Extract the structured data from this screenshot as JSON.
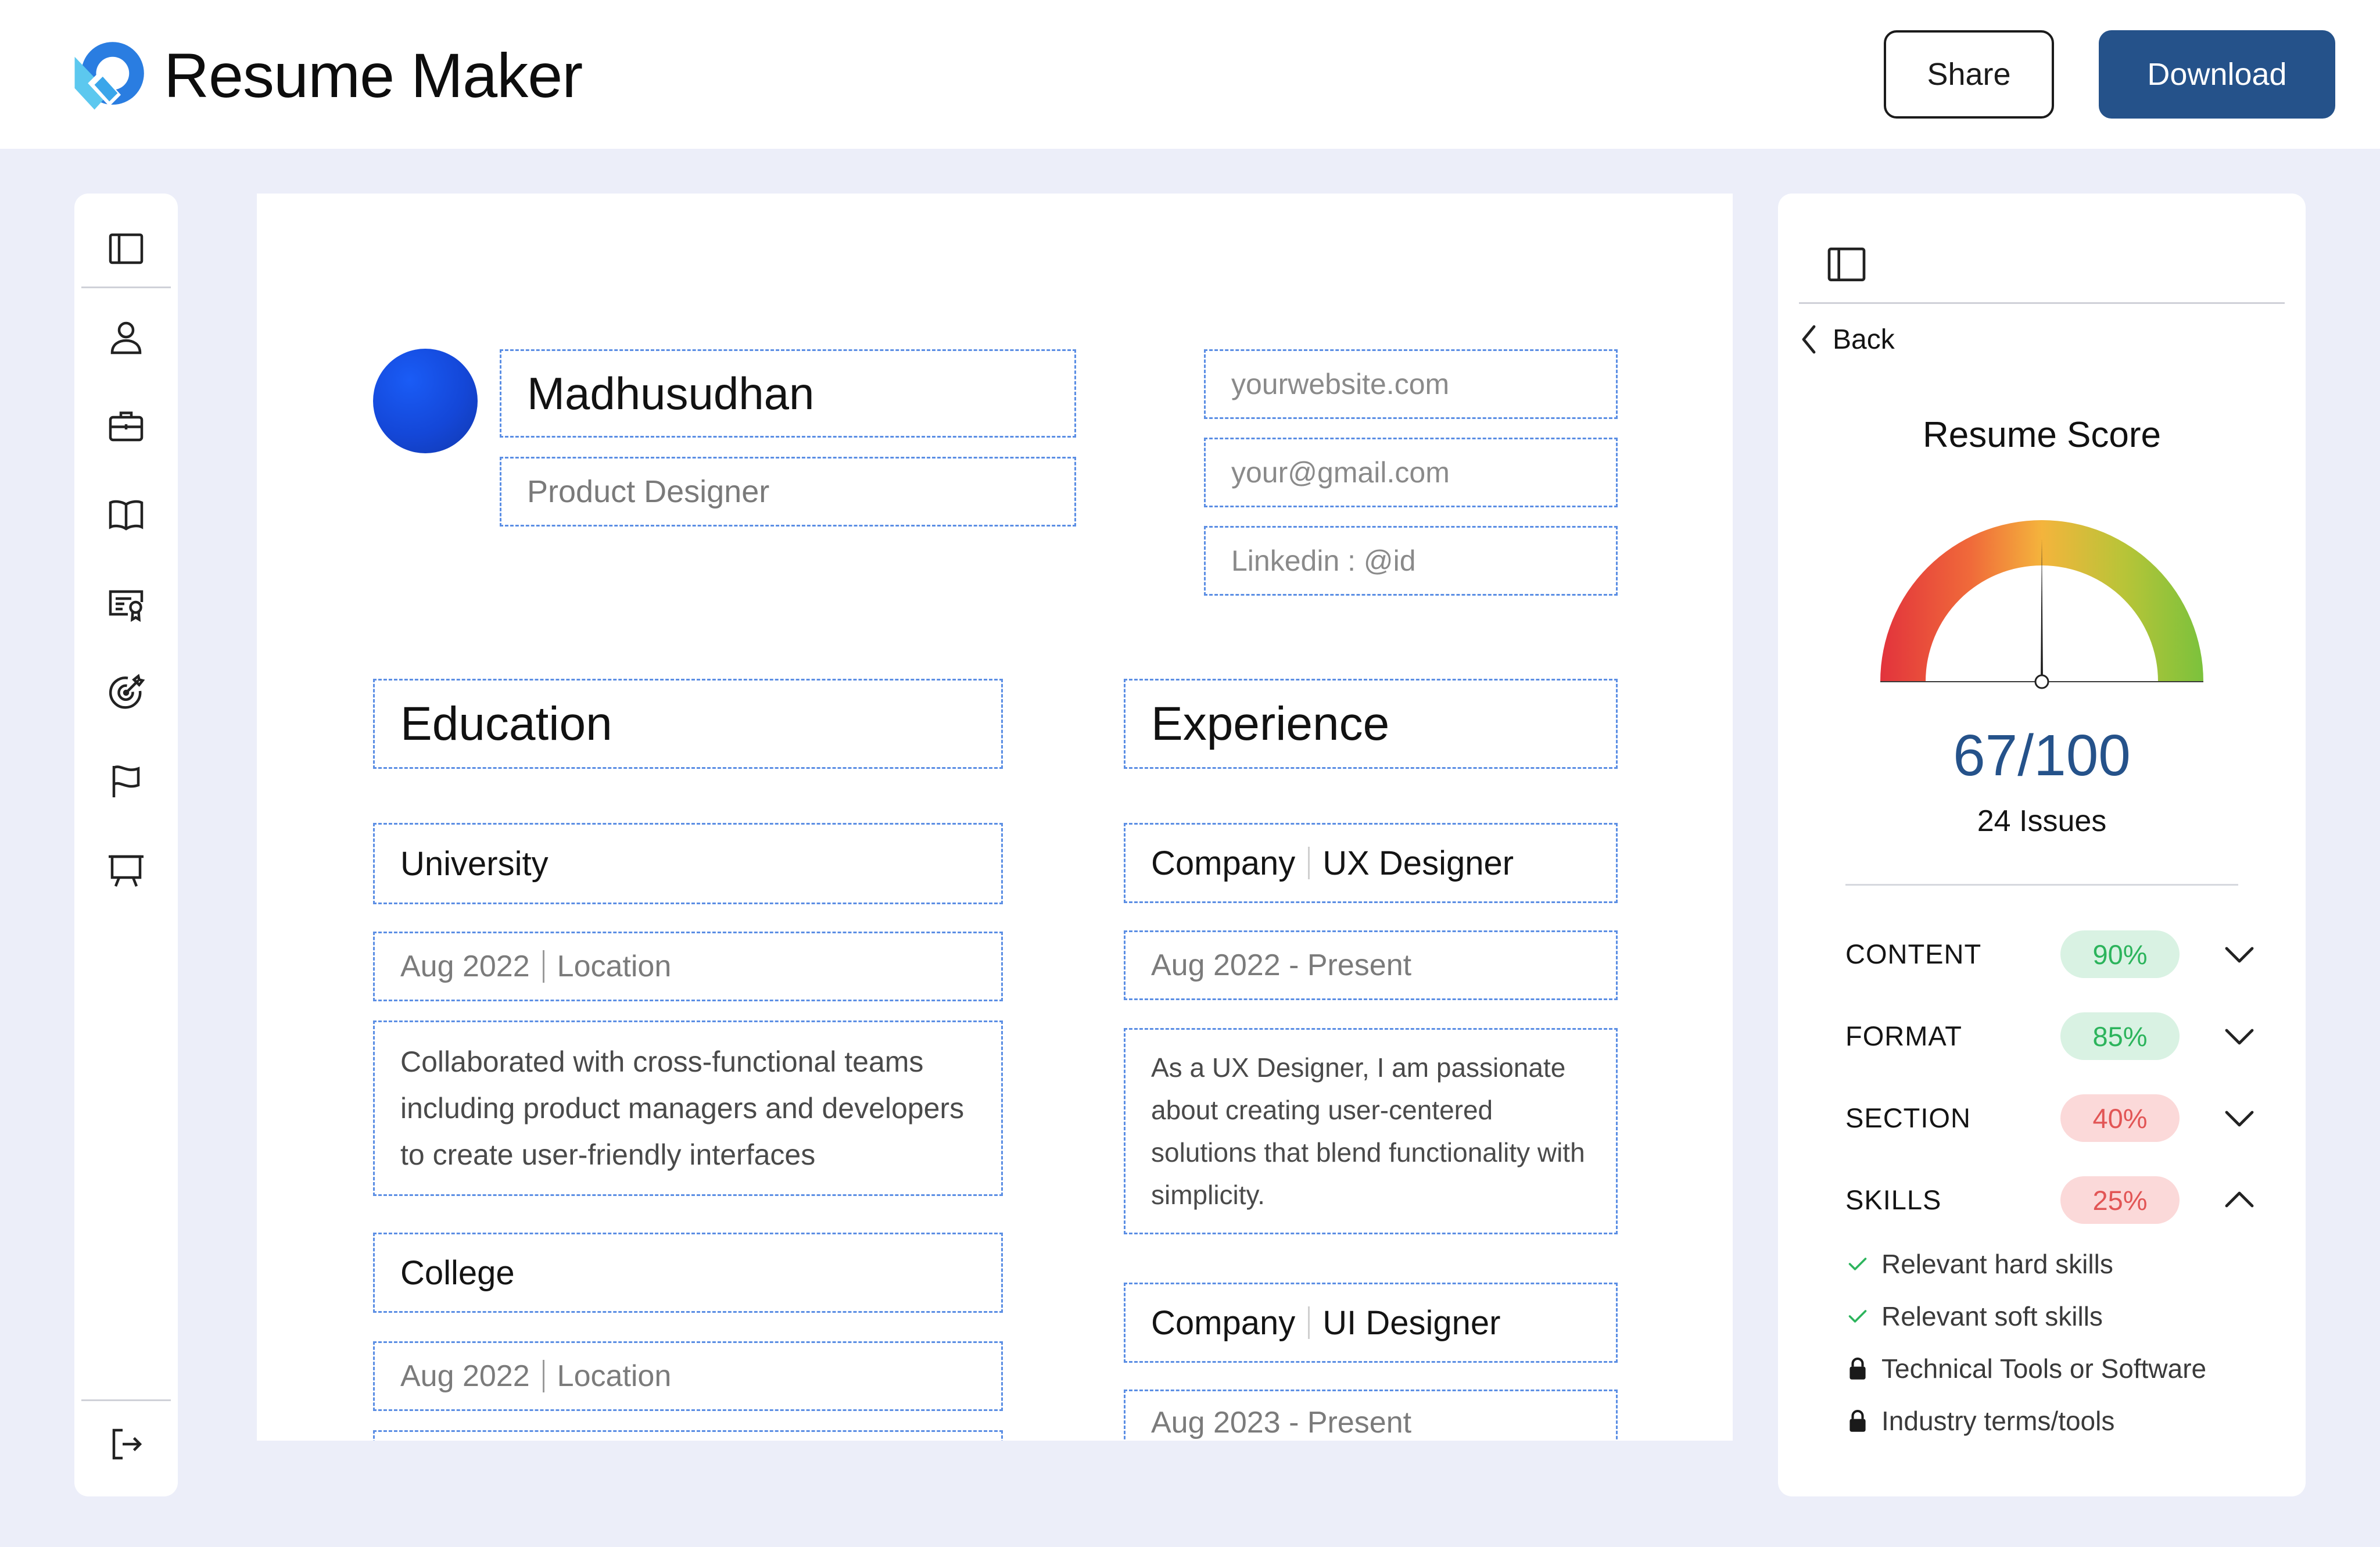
{
  "app": {
    "title": "Resume Maker"
  },
  "header": {
    "share_label": "Share",
    "download_label": "Download"
  },
  "sidebar": {
    "items": [
      {
        "icon": "layout-panel-icon",
        "label": "Toggle sidebar"
      },
      {
        "icon": "user-icon",
        "label": "Profile"
      },
      {
        "icon": "briefcase-icon",
        "label": "Experience"
      },
      {
        "icon": "book-icon",
        "label": "Education"
      },
      {
        "icon": "certificate-icon",
        "label": "Certifications"
      },
      {
        "icon": "target-icon",
        "label": "Goals"
      },
      {
        "icon": "flag-icon",
        "label": "Achievements"
      },
      {
        "icon": "presentation-icon",
        "label": "Projects"
      },
      {
        "icon": "logout-icon",
        "label": "Log out"
      }
    ]
  },
  "resume": {
    "name": "Madhusudhan",
    "role": "Product Designer",
    "contact": {
      "website": "yourwebsite.com",
      "email": "your@gmail.com",
      "linkedin": "Linkedin : @id"
    },
    "education": {
      "heading": "Education",
      "entries": [
        {
          "institution": "University",
          "date": "Aug 2022",
          "location": "Location",
          "description": "Collaborated with cross-functional teams including product managers and developers to create user-friendly interfaces"
        },
        {
          "institution": "College",
          "date": "Aug 2022",
          "location": "Location"
        }
      ]
    },
    "experience": {
      "heading": "Experience",
      "entries": [
        {
          "company": "Company",
          "title": "UX Designer",
          "dates": "Aug 2022 - Present",
          "description": "As a UX Designer, I am passionate about creating user-centered solutions that blend functionality with simplicity."
        },
        {
          "company": "Company",
          "title": "UI Designer",
          "dates": "Aug 2023 - Present"
        }
      ]
    }
  },
  "score_panel": {
    "back_label": "Back",
    "title": "Resume Score",
    "score_text": "67/100",
    "score": 67,
    "score_max": 100,
    "issues_label": "24 Issues",
    "metrics": [
      {
        "label": "CONTENT",
        "value": "90%",
        "status": "good",
        "expanded": false
      },
      {
        "label": "FORMAT",
        "value": "85%",
        "status": "good",
        "expanded": false
      },
      {
        "label": "SECTION",
        "value": "40%",
        "status": "bad",
        "expanded": false
      },
      {
        "label": "SKILLS",
        "value": "25%",
        "status": "bad",
        "expanded": true
      }
    ],
    "skills_checklist": [
      {
        "label": "Relevant hard skills",
        "state": "done"
      },
      {
        "label": "Relevant soft skills",
        "state": "done"
      },
      {
        "label": "Technical Tools or Software",
        "state": "locked"
      },
      {
        "label": "Industry terms/tools",
        "state": "locked"
      }
    ],
    "colors": {
      "accent": "#25528a",
      "good_bg": "#d9f2e3",
      "good_text": "#2cb45c",
      "bad_bg": "#fbd9d9",
      "bad_text": "#e25555"
    }
  }
}
